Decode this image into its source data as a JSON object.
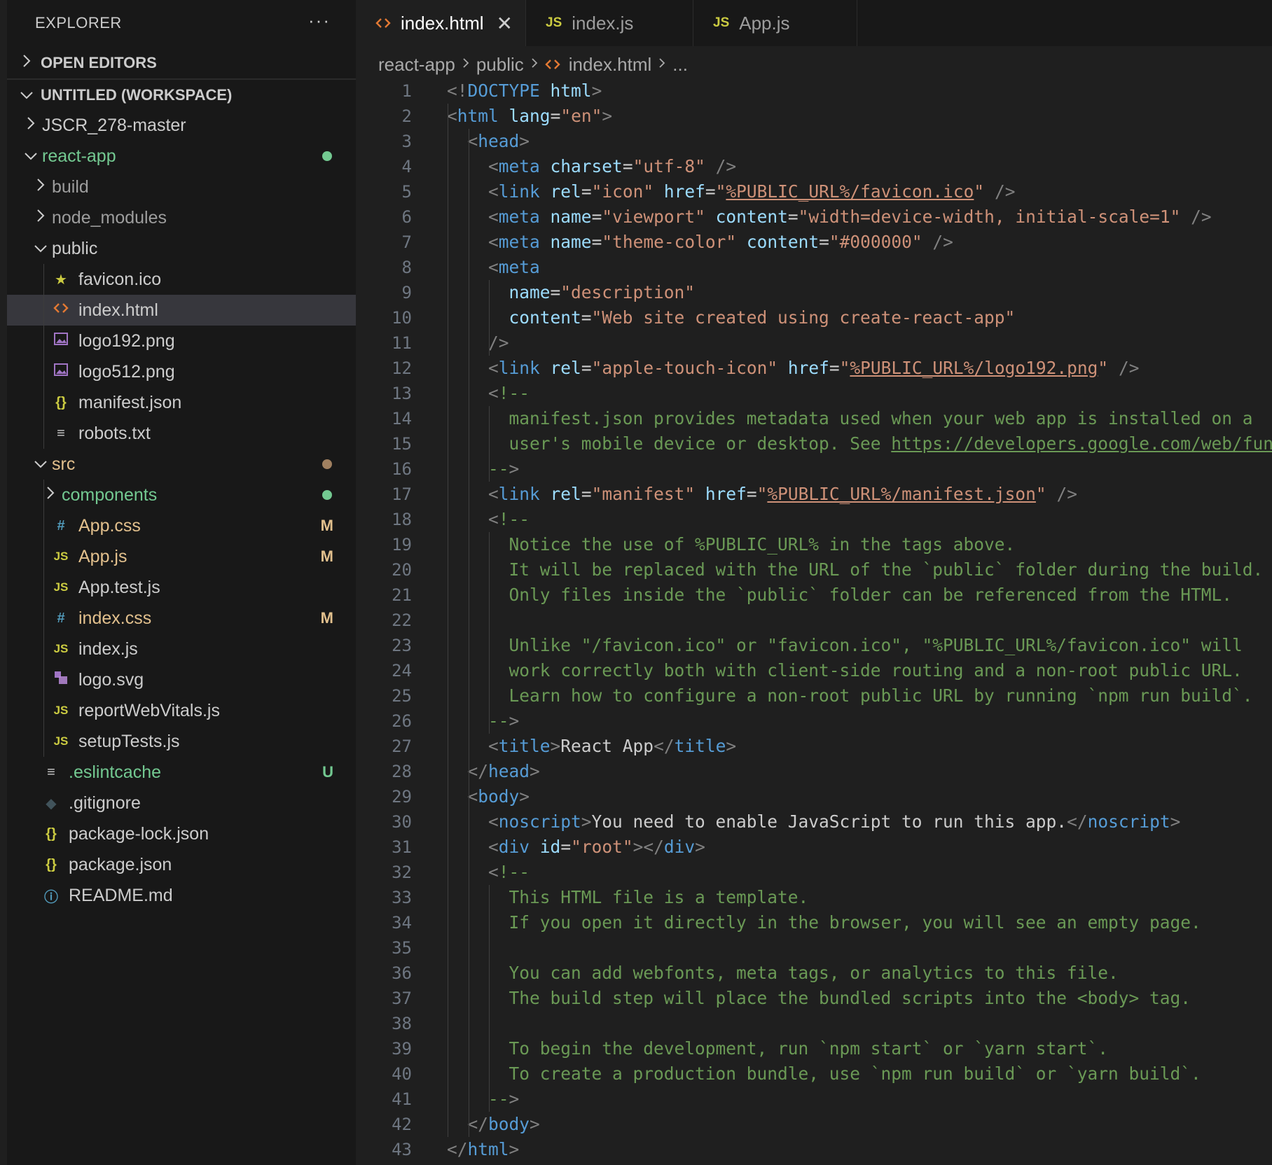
{
  "explorer": {
    "title": "EXPLORER",
    "more": "···",
    "open_editors": "OPEN EDITORS",
    "workspace": "UNTITLED (WORKSPACE)"
  },
  "tree": [
    {
      "label": "JSCR_278-master",
      "depth": 0,
      "kind": "folder",
      "open": false
    },
    {
      "label": "react-app",
      "depth": 0,
      "kind": "folder",
      "open": true,
      "color": "#73c991",
      "dot": "#73c991"
    },
    {
      "label": "build",
      "depth": 1,
      "kind": "folder",
      "open": false,
      "color": "#9d9d9d"
    },
    {
      "label": "node_modules",
      "depth": 1,
      "kind": "folder",
      "open": false,
      "color": "#9d9d9d"
    },
    {
      "label": "public",
      "depth": 1,
      "kind": "folder",
      "open": true
    },
    {
      "label": "favicon.ico",
      "depth": 2,
      "kind": "file",
      "icon": "star-icon"
    },
    {
      "label": "index.html",
      "depth": 2,
      "kind": "file",
      "icon": "html-icon",
      "selected": true
    },
    {
      "label": "logo192.png",
      "depth": 2,
      "kind": "file",
      "icon": "image-icon"
    },
    {
      "label": "logo512.png",
      "depth": 2,
      "kind": "file",
      "icon": "image-icon"
    },
    {
      "label": "manifest.json",
      "depth": 2,
      "kind": "file",
      "icon": "json-icon"
    },
    {
      "label": "robots.txt",
      "depth": 2,
      "kind": "file",
      "icon": "text-icon"
    },
    {
      "label": "src",
      "depth": 1,
      "kind": "folder",
      "open": true,
      "color": "#e2c08d",
      "dot": "#a08060"
    },
    {
      "label": "components",
      "depth": 2,
      "kind": "folder",
      "open": false,
      "color": "#73c991",
      "dot": "#73c991"
    },
    {
      "label": "App.css",
      "depth": 2,
      "kind": "file",
      "icon": "hash-icon",
      "color": "#e2c08d",
      "badge": "M"
    },
    {
      "label": "App.js",
      "depth": 2,
      "kind": "file",
      "icon": "js-icon",
      "color": "#e2c08d",
      "badge": "M"
    },
    {
      "label": "App.test.js",
      "depth": 2,
      "kind": "file",
      "icon": "js-icon"
    },
    {
      "label": "index.css",
      "depth": 2,
      "kind": "file",
      "icon": "hash-icon",
      "color": "#e2c08d",
      "badge": "M"
    },
    {
      "label": "index.js",
      "depth": 2,
      "kind": "file",
      "icon": "js-icon"
    },
    {
      "label": "logo.svg",
      "depth": 2,
      "kind": "file",
      "icon": "svg-icon"
    },
    {
      "label": "reportWebVitals.js",
      "depth": 2,
      "kind": "file",
      "icon": "js-icon"
    },
    {
      "label": "setupTests.js",
      "depth": 2,
      "kind": "file",
      "icon": "js-icon"
    },
    {
      "label": ".eslintcache",
      "depth": 1,
      "kind": "file",
      "icon": "text-icon",
      "color": "#73c991",
      "badge": "U"
    },
    {
      "label": ".gitignore",
      "depth": 1,
      "kind": "file",
      "icon": "git-icon"
    },
    {
      "label": "package-lock.json",
      "depth": 1,
      "kind": "file",
      "icon": "json-icon"
    },
    {
      "label": "package.json",
      "depth": 1,
      "kind": "file",
      "icon": "json-icon"
    },
    {
      "label": "README.md",
      "depth": 1,
      "kind": "file",
      "icon": "info-icon"
    }
  ],
  "tabs": [
    {
      "label": "index.html",
      "icon": "html-icon",
      "active": true,
      "close": "✕"
    },
    {
      "label": "index.js",
      "icon": "js-icon",
      "active": false
    },
    {
      "label": "App.js",
      "icon": "js-icon",
      "active": false
    }
  ],
  "breadcrumbs": [
    "react-app",
    "public",
    "index.html",
    "..."
  ],
  "code_lines": [
    {
      "n": "1",
      "indent": 0,
      "tokens": [
        [
          "punc",
          "<!"
        ],
        [
          "tag",
          "DOCTYPE"
        ],
        [
          "txt",
          " "
        ],
        [
          "attr",
          "html"
        ],
        [
          "punc",
          ">"
        ]
      ]
    },
    {
      "n": "2",
      "indent": 0,
      "tokens": [
        [
          "punc",
          "<"
        ],
        [
          "tag",
          "html"
        ],
        [
          "txt",
          " "
        ],
        [
          "attr",
          "lang"
        ],
        [
          "txt",
          "="
        ],
        [
          "str",
          "\"en\""
        ],
        [
          "punc",
          ">"
        ]
      ]
    },
    {
      "n": "3",
      "indent": 1,
      "tokens": [
        [
          "punc",
          "<"
        ],
        [
          "tag",
          "head"
        ],
        [
          "punc",
          ">"
        ]
      ]
    },
    {
      "n": "4",
      "indent": 2,
      "tokens": [
        [
          "punc",
          "<"
        ],
        [
          "tag",
          "meta"
        ],
        [
          "txt",
          " "
        ],
        [
          "attr",
          "charset"
        ],
        [
          "txt",
          "="
        ],
        [
          "str",
          "\"utf-8\""
        ],
        [
          "txt",
          " "
        ],
        [
          "punc",
          "/>"
        ]
      ]
    },
    {
      "n": "5",
      "indent": 2,
      "tokens": [
        [
          "punc",
          "<"
        ],
        [
          "tag",
          "link"
        ],
        [
          "txt",
          " "
        ],
        [
          "attr",
          "rel"
        ],
        [
          "txt",
          "="
        ],
        [
          "str",
          "\"icon\""
        ],
        [
          "txt",
          " "
        ],
        [
          "attr",
          "href"
        ],
        [
          "txt",
          "="
        ],
        [
          "str",
          "\""
        ],
        [
          "strlink",
          "%PUBLIC_URL%/favicon.ico"
        ],
        [
          "str",
          "\""
        ],
        [
          "txt",
          " "
        ],
        [
          "punc",
          "/>"
        ]
      ]
    },
    {
      "n": "6",
      "indent": 2,
      "tokens": [
        [
          "punc",
          "<"
        ],
        [
          "tag",
          "meta"
        ],
        [
          "txt",
          " "
        ],
        [
          "attr",
          "name"
        ],
        [
          "txt",
          "="
        ],
        [
          "str",
          "\"viewport\""
        ],
        [
          "txt",
          " "
        ],
        [
          "attr",
          "content"
        ],
        [
          "txt",
          "="
        ],
        [
          "str",
          "\"width=device-width, initial-scale=1\""
        ],
        [
          "txt",
          " "
        ],
        [
          "punc",
          "/>"
        ]
      ]
    },
    {
      "n": "7",
      "indent": 2,
      "tokens": [
        [
          "punc",
          "<"
        ],
        [
          "tag",
          "meta"
        ],
        [
          "txt",
          " "
        ],
        [
          "attr",
          "name"
        ],
        [
          "txt",
          "="
        ],
        [
          "str",
          "\"theme-color\""
        ],
        [
          "txt",
          " "
        ],
        [
          "attr",
          "content"
        ],
        [
          "txt",
          "="
        ],
        [
          "str",
          "\"#000000\""
        ],
        [
          "txt",
          " "
        ],
        [
          "punc",
          "/>"
        ]
      ]
    },
    {
      "n": "8",
      "indent": 2,
      "tokens": [
        [
          "punc",
          "<"
        ],
        [
          "tag",
          "meta"
        ]
      ]
    },
    {
      "n": "9",
      "indent": 3,
      "tokens": [
        [
          "attr",
          "name"
        ],
        [
          "txt",
          "="
        ],
        [
          "str",
          "\"description\""
        ]
      ]
    },
    {
      "n": "10",
      "indent": 3,
      "tokens": [
        [
          "attr",
          "content"
        ],
        [
          "txt",
          "="
        ],
        [
          "str",
          "\"Web site created using create-react-app\""
        ]
      ]
    },
    {
      "n": "11",
      "indent": 2,
      "tokens": [
        [
          "punc",
          "/>"
        ]
      ]
    },
    {
      "n": "12",
      "indent": 2,
      "tokens": [
        [
          "punc",
          "<"
        ],
        [
          "tag",
          "link"
        ],
        [
          "txt",
          " "
        ],
        [
          "attr",
          "rel"
        ],
        [
          "txt",
          "="
        ],
        [
          "str",
          "\"apple-touch-icon\""
        ],
        [
          "txt",
          " "
        ],
        [
          "attr",
          "href"
        ],
        [
          "txt",
          "="
        ],
        [
          "str",
          "\""
        ],
        [
          "strlink",
          "%PUBLIC_URL%/logo192.png"
        ],
        [
          "str",
          "\""
        ],
        [
          "txt",
          " "
        ],
        [
          "punc",
          "/>"
        ]
      ]
    },
    {
      "n": "13",
      "indent": 2,
      "tokens": [
        [
          "punc",
          "<"
        ],
        [
          "com",
          "!--"
        ]
      ]
    },
    {
      "n": "14",
      "indent": 3,
      "tokens": [
        [
          "com",
          "manifest.json provides metadata used when your web app is installed on a"
        ]
      ]
    },
    {
      "n": "15",
      "indent": 3,
      "tokens": [
        [
          "com",
          "user's mobile device or desktop. See "
        ],
        [
          "comlink",
          "https://developers.google.com/web/fundamentals/web-app-manifest/"
        ]
      ]
    },
    {
      "n": "16",
      "indent": 2,
      "tokens": [
        [
          "com",
          "--"
        ],
        [
          "punc",
          ">"
        ]
      ]
    },
    {
      "n": "17",
      "indent": 2,
      "tokens": [
        [
          "punc",
          "<"
        ],
        [
          "tag",
          "link"
        ],
        [
          "txt",
          " "
        ],
        [
          "attr",
          "rel"
        ],
        [
          "txt",
          "="
        ],
        [
          "str",
          "\"manifest\""
        ],
        [
          "txt",
          " "
        ],
        [
          "attr",
          "href"
        ],
        [
          "txt",
          "="
        ],
        [
          "str",
          "\""
        ],
        [
          "strlink",
          "%PUBLIC_URL%/manifest.json"
        ],
        [
          "str",
          "\""
        ],
        [
          "txt",
          " "
        ],
        [
          "punc",
          "/>"
        ]
      ]
    },
    {
      "n": "18",
      "indent": 2,
      "tokens": [
        [
          "punc",
          "<"
        ],
        [
          "com",
          "!--"
        ]
      ]
    },
    {
      "n": "19",
      "indent": 3,
      "tokens": [
        [
          "com",
          "Notice the use of %PUBLIC_URL% in the tags above."
        ]
      ]
    },
    {
      "n": "20",
      "indent": 3,
      "tokens": [
        [
          "com",
          "It will be replaced with the URL of the `public` folder during the build."
        ]
      ]
    },
    {
      "n": "21",
      "indent": 3,
      "tokens": [
        [
          "com",
          "Only files inside the `public` folder can be referenced from the HTML."
        ]
      ]
    },
    {
      "n": "22",
      "indent": 3,
      "tokens": []
    },
    {
      "n": "23",
      "indent": 3,
      "tokens": [
        [
          "com",
          "Unlike \"/favicon.ico\" or \"favicon.ico\", \"%PUBLIC_URL%/favicon.ico\" will"
        ]
      ]
    },
    {
      "n": "24",
      "indent": 3,
      "tokens": [
        [
          "com",
          "work correctly both with client-side routing and a non-root public URL."
        ]
      ]
    },
    {
      "n": "25",
      "indent": 3,
      "tokens": [
        [
          "com",
          "Learn how to configure a non-root public URL by running `npm run build`."
        ]
      ]
    },
    {
      "n": "26",
      "indent": 2,
      "tokens": [
        [
          "com",
          "--"
        ],
        [
          "punc",
          ">"
        ]
      ]
    },
    {
      "n": "27",
      "indent": 2,
      "tokens": [
        [
          "punc",
          "<"
        ],
        [
          "tag",
          "title"
        ],
        [
          "punc",
          ">"
        ],
        [
          "txt",
          "React App"
        ],
        [
          "punc",
          "</"
        ],
        [
          "tag",
          "title"
        ],
        [
          "punc",
          ">"
        ]
      ]
    },
    {
      "n": "28",
      "indent": 1,
      "tokens": [
        [
          "punc",
          "</"
        ],
        [
          "tag",
          "head"
        ],
        [
          "punc",
          ">"
        ]
      ]
    },
    {
      "n": "29",
      "indent": 1,
      "tokens": [
        [
          "punc",
          "<"
        ],
        [
          "tag",
          "body"
        ],
        [
          "punc",
          ">"
        ]
      ]
    },
    {
      "n": "30",
      "indent": 2,
      "tokens": [
        [
          "punc",
          "<"
        ],
        [
          "tag",
          "noscript"
        ],
        [
          "punc",
          ">"
        ],
        [
          "txt",
          "You need to enable JavaScript to run this app."
        ],
        [
          "punc",
          "</"
        ],
        [
          "tag",
          "noscript"
        ],
        [
          "punc",
          ">"
        ]
      ]
    },
    {
      "n": "31",
      "indent": 2,
      "tokens": [
        [
          "punc",
          "<"
        ],
        [
          "tag",
          "div"
        ],
        [
          "txt",
          " "
        ],
        [
          "attr",
          "id"
        ],
        [
          "txt",
          "="
        ],
        [
          "str",
          "\"root\""
        ],
        [
          "punc",
          "></"
        ],
        [
          "tag",
          "div"
        ],
        [
          "punc",
          ">"
        ]
      ]
    },
    {
      "n": "32",
      "indent": 2,
      "tokens": [
        [
          "punc",
          "<"
        ],
        [
          "com",
          "!--"
        ]
      ]
    },
    {
      "n": "33",
      "indent": 3,
      "tokens": [
        [
          "com",
          "This HTML file is a template."
        ]
      ]
    },
    {
      "n": "34",
      "indent": 3,
      "tokens": [
        [
          "com",
          "If you open it directly in the browser, you will see an empty page."
        ]
      ]
    },
    {
      "n": "35",
      "indent": 3,
      "tokens": []
    },
    {
      "n": "36",
      "indent": 3,
      "tokens": [
        [
          "com",
          "You can add webfonts, meta tags, or analytics to this file."
        ]
      ]
    },
    {
      "n": "37",
      "indent": 3,
      "tokens": [
        [
          "com",
          "The build step will place the bundled scripts into the <body> tag."
        ]
      ]
    },
    {
      "n": "38",
      "indent": 3,
      "tokens": []
    },
    {
      "n": "39",
      "indent": 3,
      "tokens": [
        [
          "com",
          "To begin the development, run `npm start` or `yarn start`."
        ]
      ]
    },
    {
      "n": "40",
      "indent": 3,
      "tokens": [
        [
          "com",
          "To create a production bundle, use `npm run build` or `yarn build`."
        ]
      ]
    },
    {
      "n": "41",
      "indent": 2,
      "tokens": [
        [
          "com",
          "--"
        ],
        [
          "punc",
          ">"
        ]
      ]
    },
    {
      "n": "42",
      "indent": 1,
      "tokens": [
        [
          "punc",
          "</"
        ],
        [
          "tag",
          "body"
        ],
        [
          "punc",
          ">"
        ]
      ]
    },
    {
      "n": "43",
      "indent": 0,
      "tokens": [
        [
          "punc",
          "</"
        ],
        [
          "tag",
          "html"
        ],
        [
          "punc",
          ">"
        ]
      ]
    }
  ]
}
